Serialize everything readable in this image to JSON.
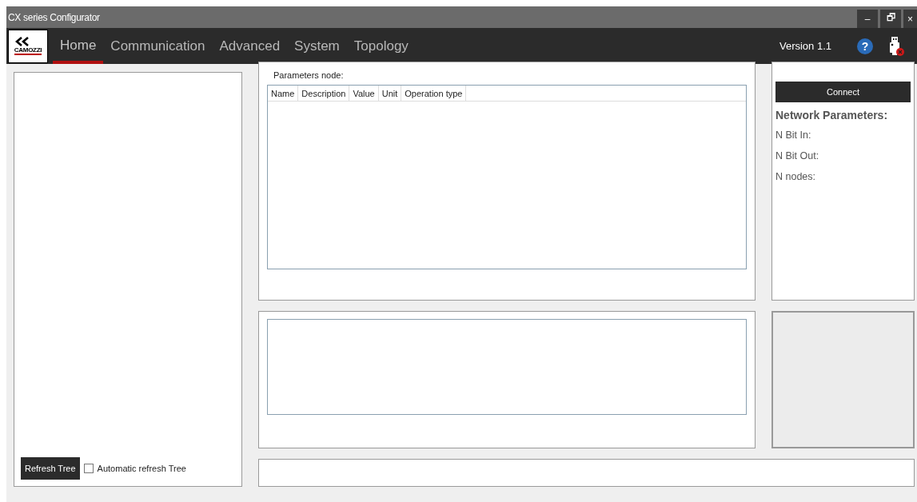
{
  "window": {
    "title": "CX series Configurator",
    "controls": [
      "–",
      "🗗",
      "×"
    ]
  },
  "logo": {
    "brand": "CAMOZZI"
  },
  "tabs": [
    {
      "label": "Home",
      "selected": true
    },
    {
      "label": "Communication",
      "selected": false
    },
    {
      "label": "Advanced",
      "selected": false
    },
    {
      "label": "System",
      "selected": false
    },
    {
      "label": "Topology",
      "selected": false
    }
  ],
  "version": "Version 1.1",
  "help_button": "?",
  "device": {
    "connected": false
  },
  "tree_panel": {
    "refresh_button": "Refresh Tree",
    "auto_refresh": {
      "label": "Automatic refresh Tree",
      "checked": false
    }
  },
  "parameters": {
    "title": "Parameters node:",
    "columns": [
      "Name",
      "Description",
      "Value",
      "Unit",
      "Operation type"
    ]
  },
  "network": {
    "connect_button": "Connect",
    "title": "Network Parameters:",
    "fields": [
      "N Bit In:",
      "N Bit Out:",
      "N nodes:"
    ]
  }
}
